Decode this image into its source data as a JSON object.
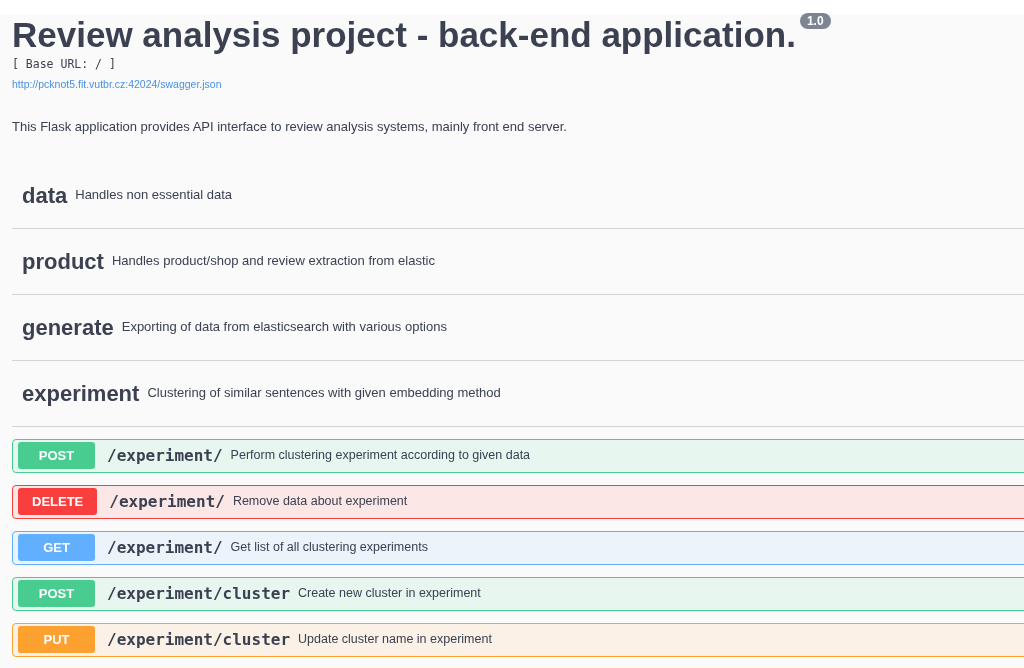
{
  "info": {
    "title": "Review analysis project - back-end application.",
    "version": "1.0",
    "base_url": "[ Base URL: / ]",
    "spec_link": "http://pcknot5.fit.vutbr.cz:42024/swagger.json",
    "description": "This Flask application provides API interface to review analysis systems, mainly front end server."
  },
  "tags": [
    {
      "name": "data",
      "description": "Handles non essential data"
    },
    {
      "name": "product",
      "description": "Handles product/shop and review extraction from elastic"
    },
    {
      "name": "generate",
      "description": "Exporting of data from elasticsearch with various options"
    },
    {
      "name": "experiment",
      "description": "Clustering of similar sentences with given embedding method"
    }
  ],
  "operations": [
    {
      "kind": "post",
      "method": "POST",
      "path": "/experiment/",
      "summary": "Perform clustering experiment according to given data"
    },
    {
      "kind": "delete",
      "method": "DELETE",
      "path": "/experiment/",
      "summary": "Remove data about experiment"
    },
    {
      "kind": "get",
      "method": "GET",
      "path": "/experiment/",
      "summary": "Get list of all clustering experiments"
    },
    {
      "kind": "post",
      "method": "POST",
      "path": "/experiment/cluster",
      "summary": "Create new cluster in experiment"
    },
    {
      "kind": "put",
      "method": "PUT",
      "path": "/experiment/cluster",
      "summary": "Update cluster name in experiment"
    }
  ]
}
